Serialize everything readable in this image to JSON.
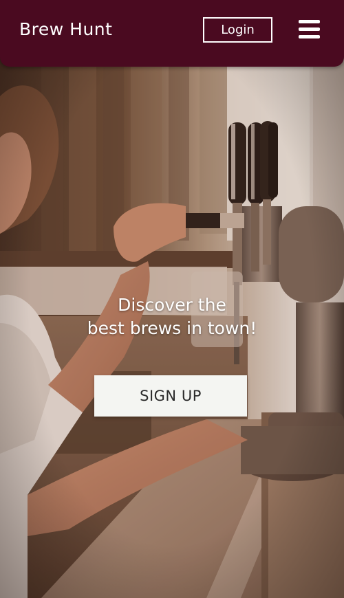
{
  "header": {
    "brand": "Brew Hunt",
    "login_label": "Login",
    "menu_icon": "hamburger-menu-icon"
  },
  "hero": {
    "tagline_line1": "Discover the",
    "tagline_line2": "best brews in town!",
    "signup_label": "SIGN UP",
    "background": "photo of a bartender pulling a tap"
  },
  "colors": {
    "header_bg": "#4a0a20",
    "button_bg": "#f4f5f2",
    "text_light": "#ffffff",
    "text_dark": "#2a2a2a"
  }
}
